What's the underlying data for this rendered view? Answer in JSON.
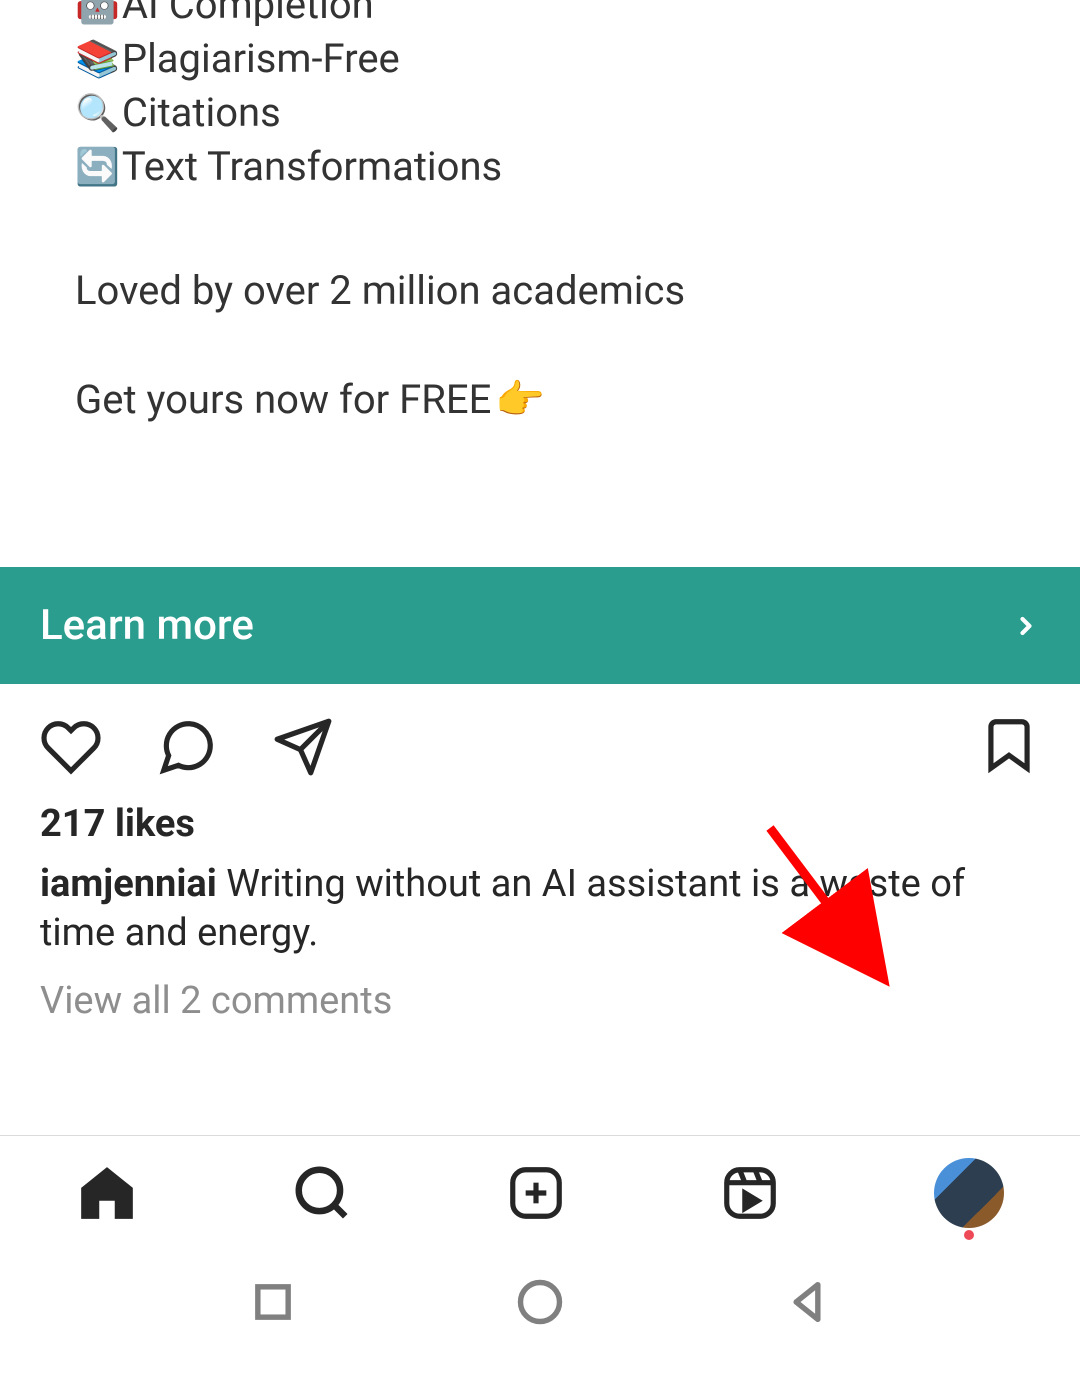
{
  "post": {
    "features": [
      {
        "emoji": "🤖",
        "label": "AI Completion"
      },
      {
        "emoji": "📚",
        "label": "Plagiarism-Free"
      },
      {
        "emoji": "🔍",
        "label": "Citations"
      },
      {
        "emoji": "🔄",
        "label": "Text Transformations"
      }
    ],
    "tagline": "Loved by over 2 million academics",
    "cta_text": "Get yours now for FREE",
    "cta_emoji": "👉"
  },
  "cta_button": {
    "label": "Learn more"
  },
  "engagement": {
    "likes_text": "217 likes",
    "username": "iamjenniai",
    "caption": "Writing without an AI assistant is a waste of time and energy.",
    "comments_link": "View all 2 comments"
  }
}
